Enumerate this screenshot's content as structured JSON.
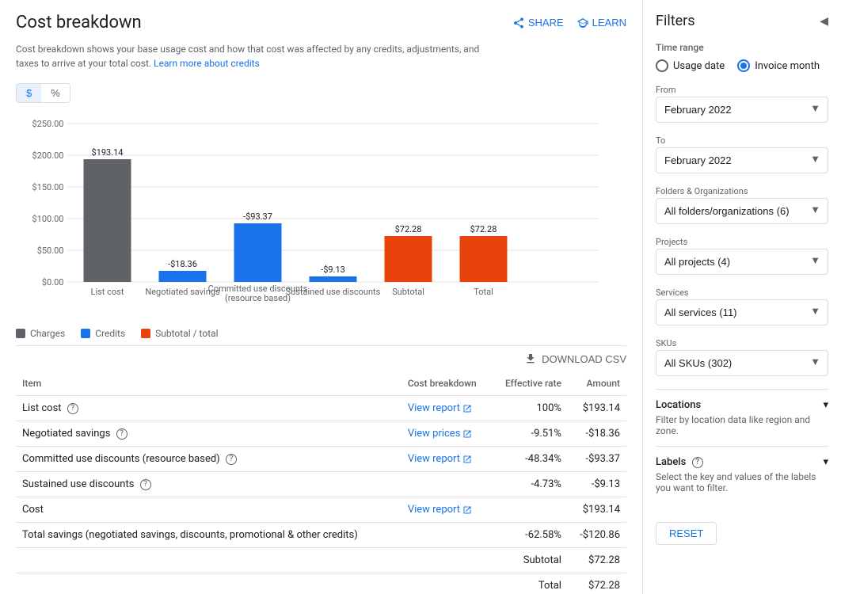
{
  "page": {
    "title": "Cost breakdown",
    "share_label": "SHARE",
    "learn_label": "LEARN",
    "description": "Cost breakdown shows your base usage cost and how that cost was affected by any credits, adjustments, and taxes to arrive at your total cost.",
    "learn_link": "Learn more about credits"
  },
  "toggle": {
    "dollar_label": "$",
    "percent_label": "%"
  },
  "chart": {
    "y_labels": [
      "$0.00",
      "$50.00",
      "$100.00",
      "$150.00",
      "$200.00",
      "$250.00"
    ],
    "bars": [
      {
        "label": "List cost",
        "value": "$193.14",
        "type": "charge"
      },
      {
        "label": "Negotiated savings",
        "value": "-$18.36",
        "type": "credit"
      },
      {
        "label": "Committed use discounts\n(resource based)",
        "value": "-$93.37",
        "type": "credit"
      },
      {
        "label": "Sustained use discounts",
        "value": "-$9.13",
        "type": "credit"
      },
      {
        "label": "Subtotal",
        "value": "$72.28",
        "type": "subtotal"
      },
      {
        "label": "Total",
        "value": "$72.28",
        "type": "subtotal"
      }
    ],
    "legend": [
      {
        "label": "Charges",
        "color": "#5f6368"
      },
      {
        "label": "Credits",
        "color": "#1a73e8"
      },
      {
        "label": "Subtotal / total",
        "color": "#e8430a"
      }
    ]
  },
  "download": {
    "label": "DOWNLOAD CSV"
  },
  "table": {
    "headers": [
      "Item",
      "Cost breakdown",
      "Effective rate",
      "Amount"
    ],
    "rows": [
      {
        "item": "List cost",
        "cost_breakdown": "View report",
        "effective_rate": "100%",
        "amount": "$193.14",
        "has_help": true,
        "has_link": true,
        "link_type": "report"
      },
      {
        "item": "Negotiated savings",
        "cost_breakdown": "View prices",
        "effective_rate": "-9.51%",
        "amount": "-$18.36",
        "has_help": true,
        "has_link": true,
        "link_type": "prices"
      },
      {
        "item": "Committed use discounts (resource based)",
        "cost_breakdown": "View report",
        "effective_rate": "-48.34%",
        "amount": "-$93.37",
        "has_help": true,
        "has_link": true,
        "link_type": "report"
      },
      {
        "item": "Sustained use discounts",
        "cost_breakdown": "",
        "effective_rate": "-4.73%",
        "amount": "-$9.13",
        "has_help": true,
        "has_link": false
      },
      {
        "item": "Cost",
        "cost_breakdown": "View report",
        "effective_rate": "",
        "amount": "$193.14",
        "has_help": false,
        "has_link": true,
        "link_type": "report"
      },
      {
        "item": "Total savings (negotiated savings, discounts, promotional & other credits)",
        "cost_breakdown": "",
        "effective_rate": "-62.58%",
        "amount": "-$120.86",
        "has_help": false,
        "has_link": false
      }
    ],
    "subtotal_row": {
      "label": "Subtotal",
      "amount": "$72.28"
    },
    "total_row": {
      "label": "Total",
      "amount": "$72.28"
    }
  },
  "filters": {
    "title": "Filters",
    "collapse_icon": "◀",
    "time_range": {
      "label": "Time range",
      "usage_date_label": "Usage date",
      "invoice_month_label": "Invoice month",
      "selected": "invoice_month"
    },
    "from": {
      "label": "From",
      "value": "February 2022"
    },
    "to": {
      "label": "To",
      "value": "February 2022"
    },
    "folders": {
      "label": "Folders & Organizations",
      "value": "All folders/organizations (6)"
    },
    "projects": {
      "label": "Projects",
      "value": "All projects (4)"
    },
    "services": {
      "label": "Services",
      "value": "All services (11)"
    },
    "skus": {
      "label": "SKUs",
      "value": "All SKUs (302)"
    },
    "locations": {
      "label": "Locations",
      "description": "Filter by location data like region and zone."
    },
    "labels": {
      "label": "Labels",
      "description": "Select the key and values of the labels you want to filter."
    },
    "reset_label": "RESET"
  }
}
